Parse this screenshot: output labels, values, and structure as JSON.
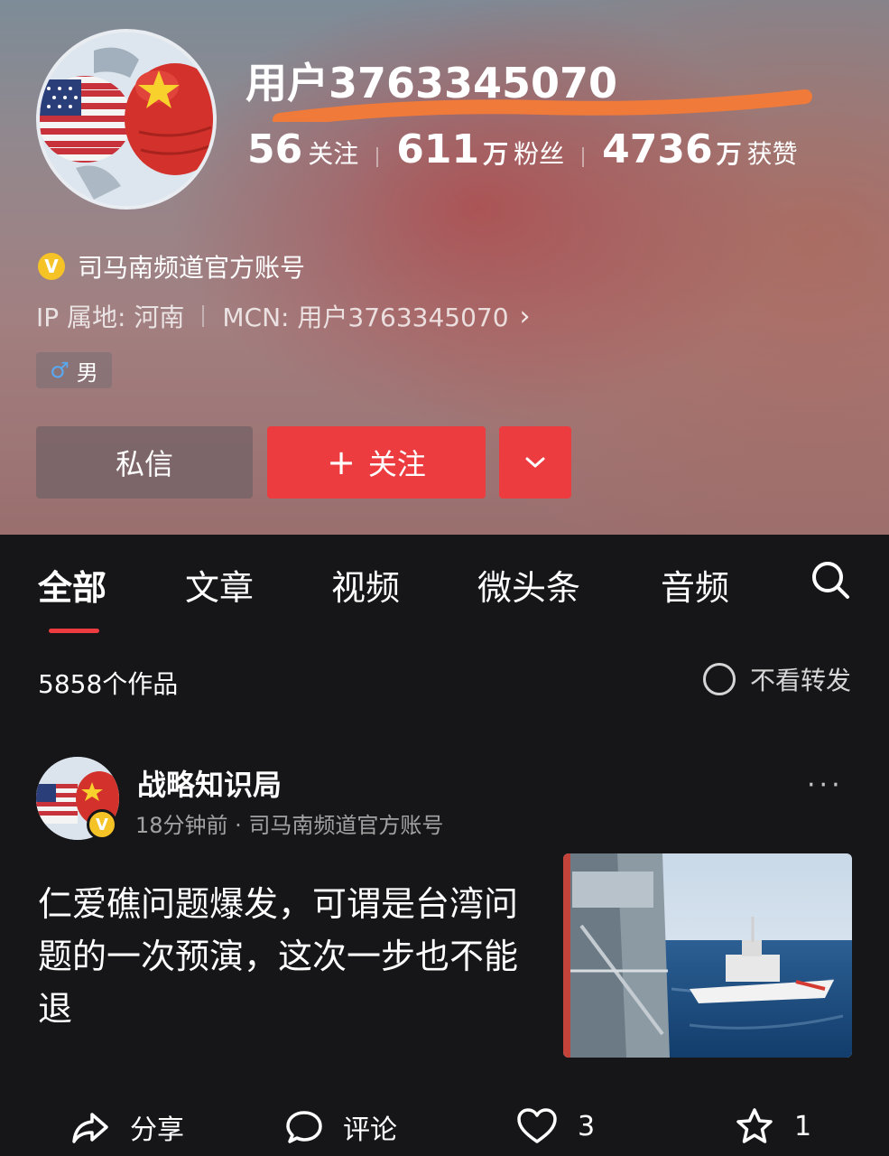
{
  "profile": {
    "username": "用户3763345070",
    "stats": {
      "following_num": "56",
      "following_label": "关注",
      "fans_num": "611",
      "fans_unit": "万",
      "fans_label": "粉丝",
      "likes_num": "4736",
      "likes_unit": "万",
      "likes_label": "获赞"
    },
    "verified_badge": "V",
    "verified_text": "司马南频道官方账号",
    "ip_location": "IP 属地: 河南",
    "mcn": "MCN: 用户3763345070",
    "mcn_chevron": "›",
    "gender_symbol": "♂",
    "gender": "男",
    "buttons": {
      "message": "私信",
      "follow_plus": "+",
      "follow": "关注"
    }
  },
  "tabs": [
    "全部",
    "文章",
    "视频",
    "微头条",
    "音频"
  ],
  "works": {
    "count": "5858个作品",
    "no_repost": "不看转发"
  },
  "post": {
    "author": "战略知识局",
    "badge": "V",
    "meta": "18分钟前 · 司马南频道官方账号",
    "menu": "···",
    "text": "仁爱礁问题爆发，可谓是台湾问题的一次预演，这次一步也不能退"
  },
  "actions": {
    "share": "分享",
    "comment": "评论",
    "like_count": "3",
    "fav_count": "1"
  },
  "colors": {
    "accent_red": "#ec3c40",
    "badge_gold": "#f6c327",
    "annotation_orange": "#f07a3a",
    "dark_bg": "#161618"
  },
  "icons": [
    "search-icon",
    "share-icon",
    "comment-icon",
    "heart-icon",
    "star-icon",
    "chevron-down-icon"
  ]
}
